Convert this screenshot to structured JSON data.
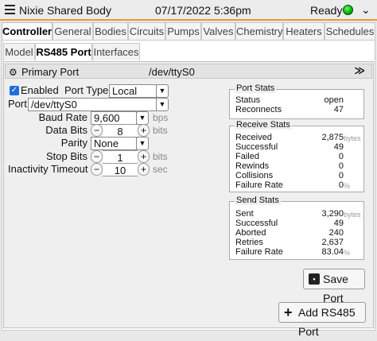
{
  "titlebar": {
    "app_title": "Nixie Shared Body",
    "datetime": "07/17/2022 5:36pm",
    "status": "Ready",
    "led_color": "#00aa00"
  },
  "main_tabs": [
    "Controller",
    "General",
    "Bodies",
    "Circuits",
    "Pumps",
    "Valves",
    "Chemistry",
    "Heaters",
    "Schedules"
  ],
  "sub_tabs": [
    "Model",
    "RS485 Port",
    "Interfaces"
  ],
  "section": {
    "title": "Primary Port",
    "value": "/dev/ttyS0"
  },
  "form": {
    "enabled_label": "Enabled",
    "port_type_label": "Port Type",
    "port_type_value": "Local",
    "port_label": "Port",
    "port_value": "/dev/ttyS0",
    "baud_label": "Baud Rate",
    "baud_value": "9,600",
    "baud_unit": "bps",
    "databits_label": "Data Bits",
    "databits_value": "8",
    "databits_unit": "bits",
    "parity_label": "Parity",
    "parity_value": "None",
    "stopbits_label": "Stop Bits",
    "stopbits_value": "1",
    "stopbits_unit": "bits",
    "timeout_label": "Inactivity Timeout",
    "timeout_value": "10",
    "timeout_unit": "sec"
  },
  "port_stats": {
    "title": "Port Stats",
    "rows": [
      {
        "label": "Status",
        "value": "open",
        "unit": ""
      },
      {
        "label": "Reconnects",
        "value": "47",
        "unit": ""
      }
    ]
  },
  "receive_stats": {
    "title": "Receive Stats",
    "rows": [
      {
        "label": "Received",
        "value": "2,875",
        "unit": "bytes"
      },
      {
        "label": "Successful",
        "value": "49",
        "unit": ""
      },
      {
        "label": "Failed",
        "value": "0",
        "unit": ""
      },
      {
        "label": "Rewinds",
        "value": "0",
        "unit": ""
      },
      {
        "label": "Collisions",
        "value": "0",
        "unit": ""
      },
      {
        "label": "Failure Rate",
        "value": "0",
        "unit": "%"
      }
    ]
  },
  "send_stats": {
    "title": "Send Stats",
    "rows": [
      {
        "label": "Sent",
        "value": "3,290",
        "unit": "bytes"
      },
      {
        "label": "Successful",
        "value": "49",
        "unit": ""
      },
      {
        "label": "Aborted",
        "value": "240",
        "unit": ""
      },
      {
        "label": "Retries",
        "value": "2,637",
        "unit": ""
      },
      {
        "label": "Failure Rate",
        "value": "83.04",
        "unit": "%"
      }
    ]
  },
  "buttons": {
    "save": "Save Port",
    "add": "Add RS485 Port"
  },
  "symbols": {
    "minus": "−",
    "plus": "+",
    "dropdown": "▼",
    "check": "✓",
    "collapse": "≫"
  }
}
